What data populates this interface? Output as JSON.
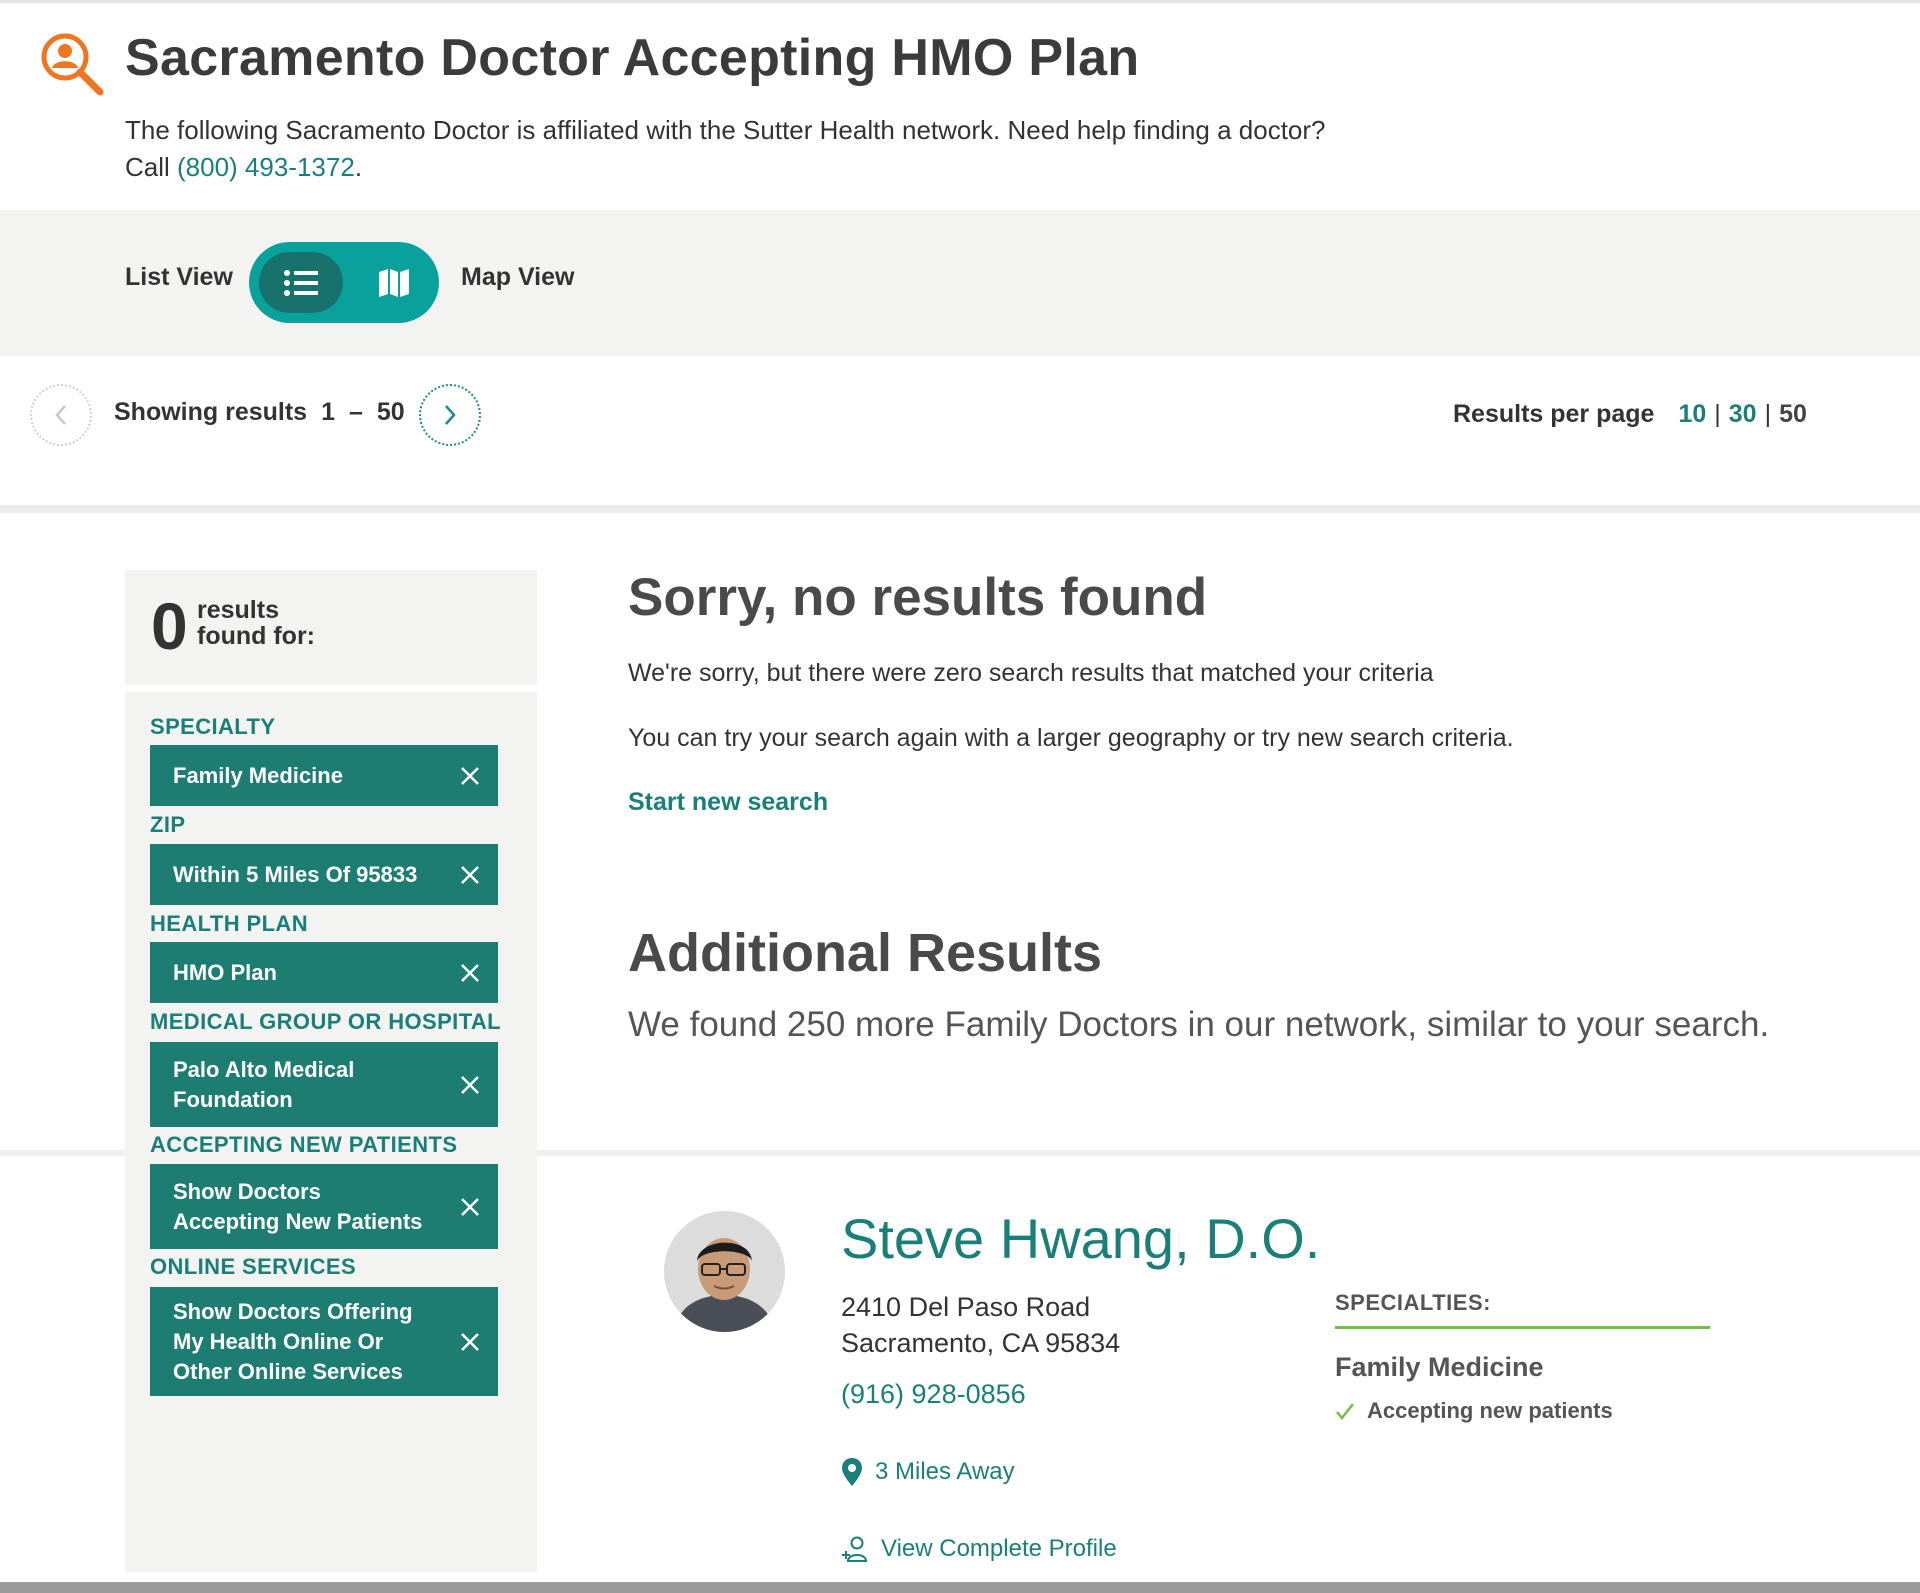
{
  "header": {
    "title": "Sacramento Doctor Accepting HMO Plan",
    "intro_text": "The following Sacramento Doctor is affiliated with the Sutter Health network. Need help finding a doctor?",
    "call_prefix": "Call ",
    "phone": "(800) 493-1372",
    "call_suffix": "."
  },
  "view_toggle": {
    "list_label": "List View",
    "map_label": "Map View",
    "active": "list"
  },
  "pagination": {
    "showing_label": "Showing results",
    "range_start": "1",
    "range_dash": "–",
    "range_end": "50",
    "per_page_label": "Results per page",
    "per_page_options": [
      "10",
      "30",
      "50"
    ],
    "per_page_current": "50"
  },
  "filters": {
    "count": "0",
    "count_line1": "results",
    "count_line2": "found for:",
    "groups": [
      {
        "label": "SPECIALTY",
        "value": "Family Medicine"
      },
      {
        "label": "ZIP",
        "value": "Within 5 Miles Of 95833"
      },
      {
        "label": "HEALTH PLAN",
        "value": "HMO Plan"
      },
      {
        "label": "MEDICAL GROUP OR HOSPITAL",
        "value": "Palo Alto Medical Foundation"
      },
      {
        "label": "ACCEPTING NEW PATIENTS",
        "value": "Show Doctors Accepting New Patients"
      },
      {
        "label": "ONLINE SERVICES",
        "value": "Show Doctors Offering My Health Online Or Other Online Services"
      }
    ]
  },
  "no_results": {
    "title": "Sorry, no results found",
    "message1": "We're sorry, but there were zero search results that matched your criteria",
    "message2": "You can try your search again with a larger geography or try new search criteria.",
    "new_search_link": "Start new search"
  },
  "additional": {
    "title": "Additional Results",
    "subtitle": "We found 250 more Family Doctors in our network, similar to your search."
  },
  "doctor": {
    "name": "Steve Hwang, D.O.",
    "address_line1": "2410 Del Paso Road",
    "address_line2": "Sacramento, CA 95834",
    "phone": "(916) 928-0856",
    "distance": "3 Miles Away",
    "profile_link": "View Complete Profile",
    "specialties_label": "SPECIALTIES:",
    "specialty": "Family Medicine",
    "accepting": "Accepting new patients"
  },
  "colors": {
    "brand_teal": "#1b7f79",
    "chip_green": "#1d7d73",
    "toggle_teal": "#0aa19c",
    "accent_orange": "#ee7623",
    "accent_green": "#72bf44"
  },
  "icons": {
    "header": "search-person-icon",
    "list": "list-icon",
    "map": "map-icon",
    "prev": "chevron-left-icon",
    "next": "chevron-right-icon",
    "remove": "close-icon",
    "location": "map-pin-icon",
    "profile": "add-person-icon",
    "check": "checkmark-icon"
  }
}
